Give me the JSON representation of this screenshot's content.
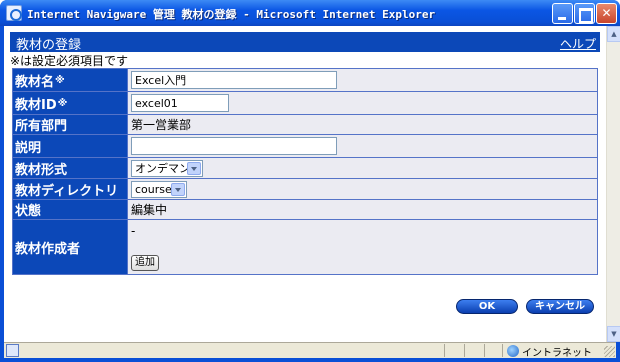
{
  "window": {
    "title": "Internet Navigware 管理 教材の登録 - Microsoft Internet Explorer",
    "minimize": "",
    "maximize": "",
    "close": "✕"
  },
  "header": {
    "title": "教材の登録",
    "help": "ヘルプ"
  },
  "note": "※は設定必須項目です",
  "form": {
    "name_label": "教材名",
    "name_value": "Excel入門",
    "id_label": "教材ID",
    "id_value": "excel01",
    "dept_label": "所有部門",
    "dept_value": "第一営業部",
    "desc_label": "説明",
    "desc_value": "",
    "format_label": "教材形式",
    "format_value": "オンデマンド",
    "dir_label": "教材ディレクトリ",
    "dir_value": "course",
    "status_label": "状態",
    "status_value": "編集中",
    "author_label": "教材作成者",
    "author_value": "-",
    "add_button": "追加",
    "required_mark": "※"
  },
  "buttons": {
    "ok": "OK",
    "cancel": "キャンセル"
  },
  "statusbar": {
    "zone": "イントラネット"
  }
}
